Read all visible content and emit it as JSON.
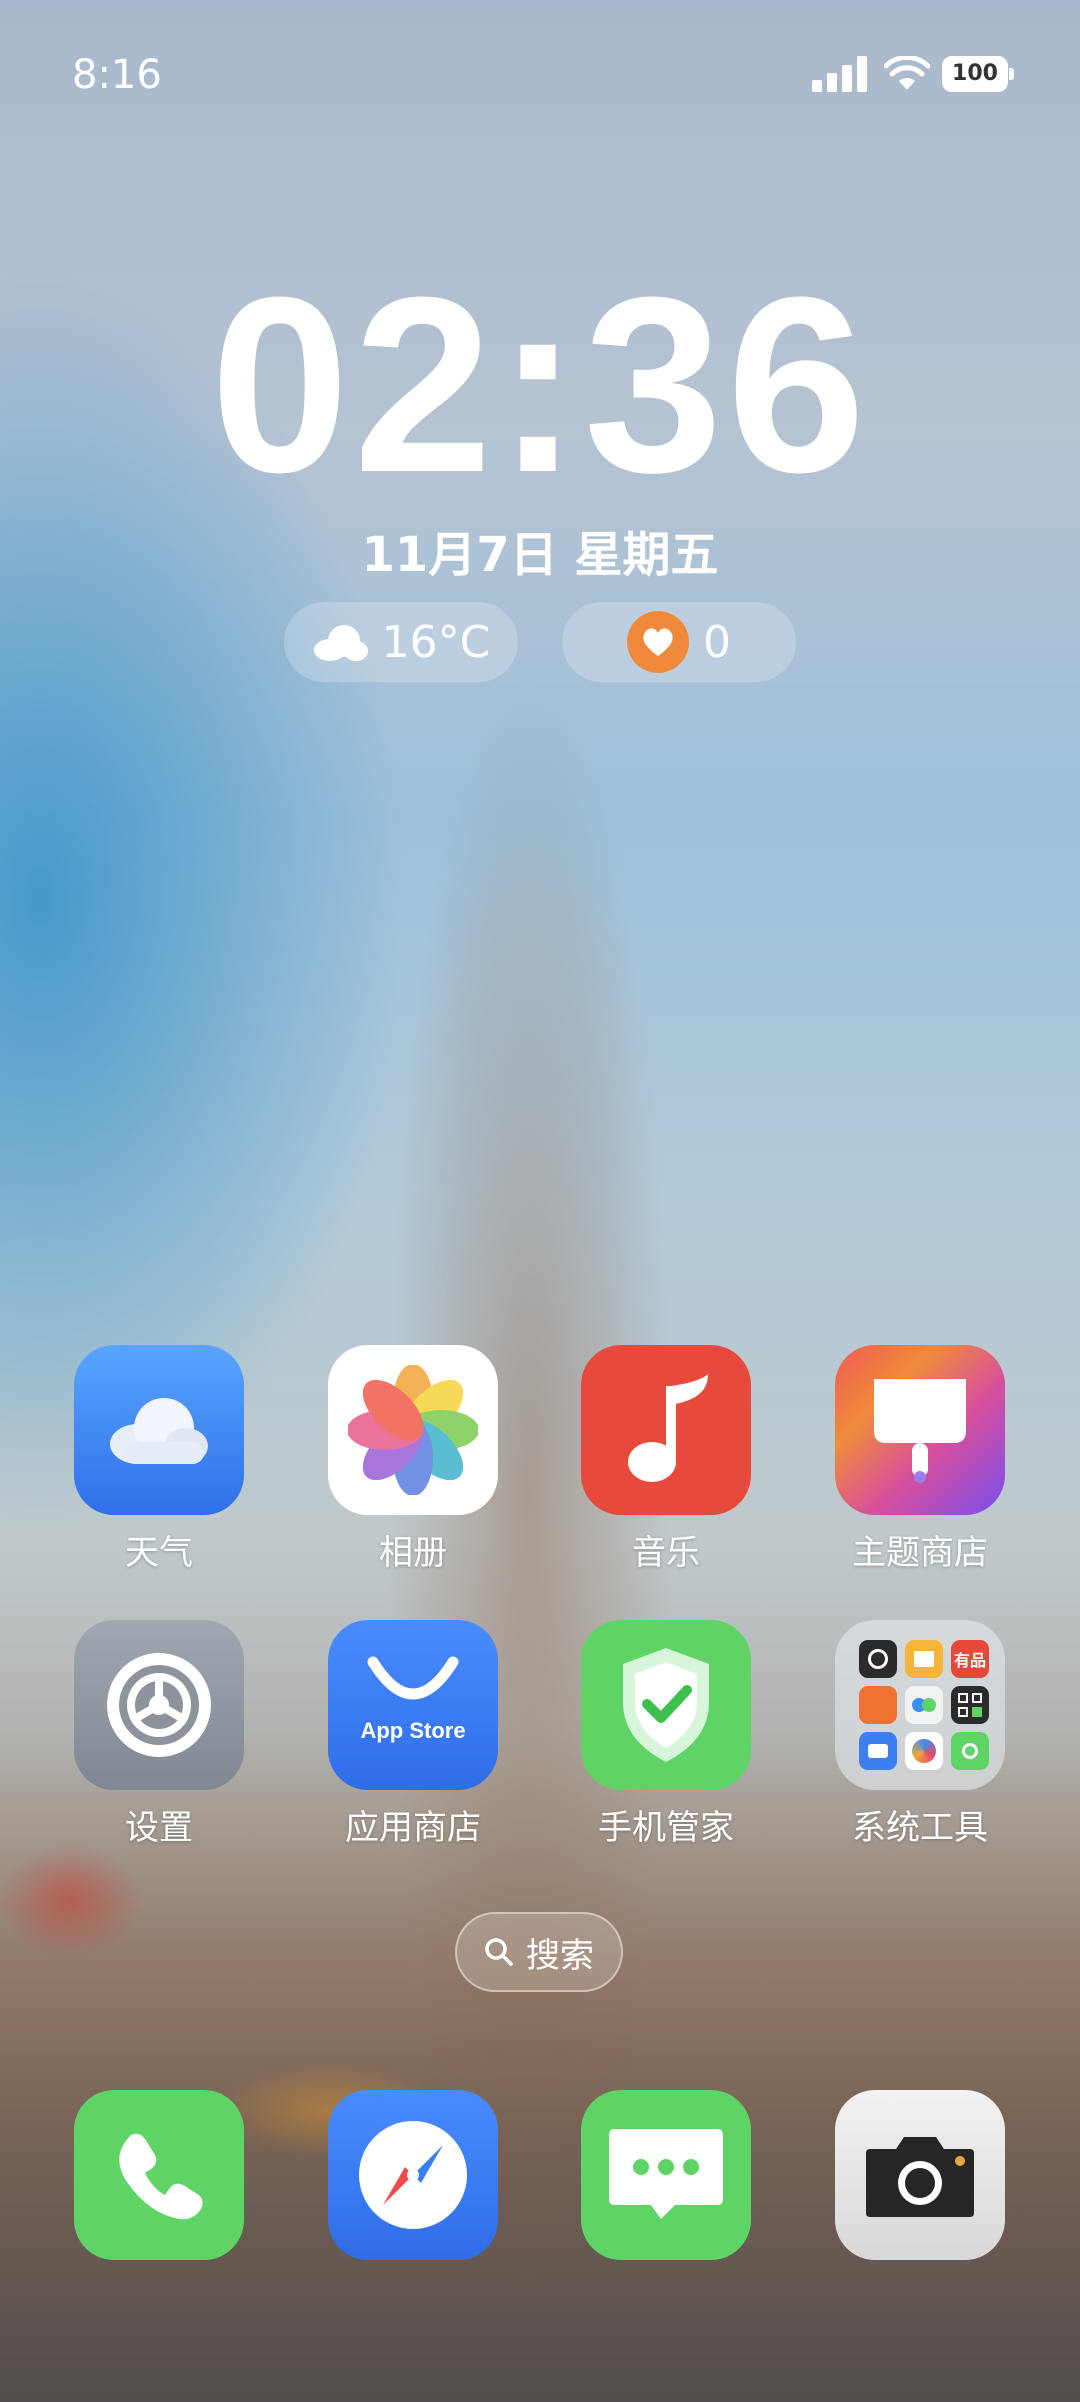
{
  "status_bar": {
    "time": "8:16",
    "battery": "100",
    "icons": [
      "signal-icon",
      "wifi-icon",
      "battery-icon"
    ]
  },
  "lock_widget": {
    "clock": "02:36",
    "date": "11月7日 星期五",
    "weather": {
      "icon": "cloud-icon",
      "temperature": "16°C"
    },
    "health": {
      "icon": "heart-hands-icon",
      "value": "0"
    }
  },
  "apps": {
    "row1": [
      {
        "label": "天气",
        "icon": "weather-icon"
      },
      {
        "label": "相册",
        "icon": "photos-icon"
      },
      {
        "label": "音乐",
        "icon": "music-icon"
      },
      {
        "label": "主题商店",
        "icon": "theme-store-icon"
      }
    ],
    "row2": [
      {
        "label": "设置",
        "icon": "settings-gear-icon"
      },
      {
        "label": "应用商店",
        "icon": "app-store-icon",
        "icon_text": "App Store"
      },
      {
        "label": "手机管家",
        "icon": "phone-manager-shield-icon"
      },
      {
        "label": "系统工具",
        "icon": "folder-icon",
        "mini_apps": [
          "clock",
          "books",
          "youpin",
          "mall",
          "toggle",
          "qr",
          "wallet",
          "browser",
          "recorder"
        ],
        "mini_texts": {
          "youpin": "有品"
        }
      }
    ]
  },
  "search": {
    "label": "搜索",
    "icon": "search-icon"
  },
  "dock": [
    {
      "icon": "phone-icon"
    },
    {
      "icon": "browser-compass-icon"
    },
    {
      "icon": "messages-icon"
    },
    {
      "icon": "camera-icon"
    }
  ],
  "colors": {
    "weather_bg": "#3d7ef3",
    "music_bg": "#e74a3d",
    "green_bg": "#5fd466",
    "settings_bg": "#8f97a2",
    "appstore_bg": "#3b7ff5",
    "camera_bg": "#e6e6e6"
  }
}
